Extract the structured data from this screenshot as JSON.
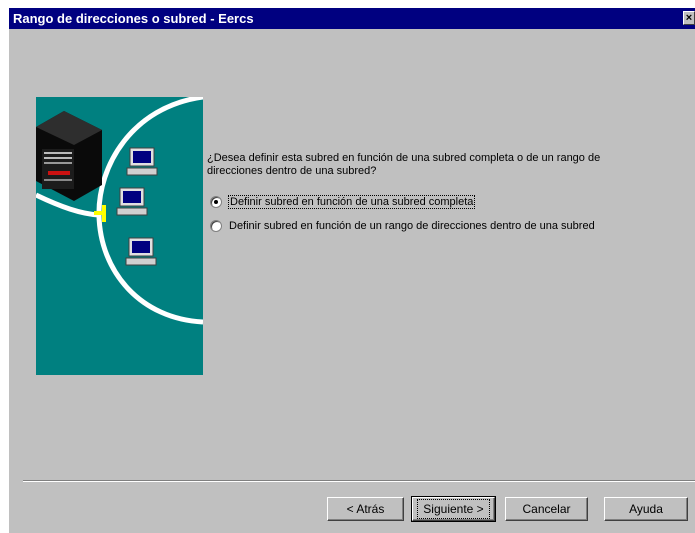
{
  "window": {
    "title": "Rango de direcciones o subred - Eercs",
    "close_glyph": "×"
  },
  "question": "¿Desea definir esta subred en función de una subred completa o de un rango de direcciones dentro de una subred?",
  "options": [
    {
      "label": "Definir subred en función de una subred completa",
      "selected": true
    },
    {
      "label": "Definir subred en función de un rango de direcciones dentro de una subred",
      "selected": false
    }
  ],
  "buttons": {
    "back": "< Atrás",
    "next": "Siguiente >",
    "cancel": "Cancelar",
    "help": "Ayuda"
  },
  "colors": {
    "titlebar": "#000080",
    "panel": "#c0c0c0",
    "art_background": "#008080"
  },
  "icons": [
    "server-icon",
    "computer-icon",
    "network-cable-icon",
    "connector-icon"
  ]
}
